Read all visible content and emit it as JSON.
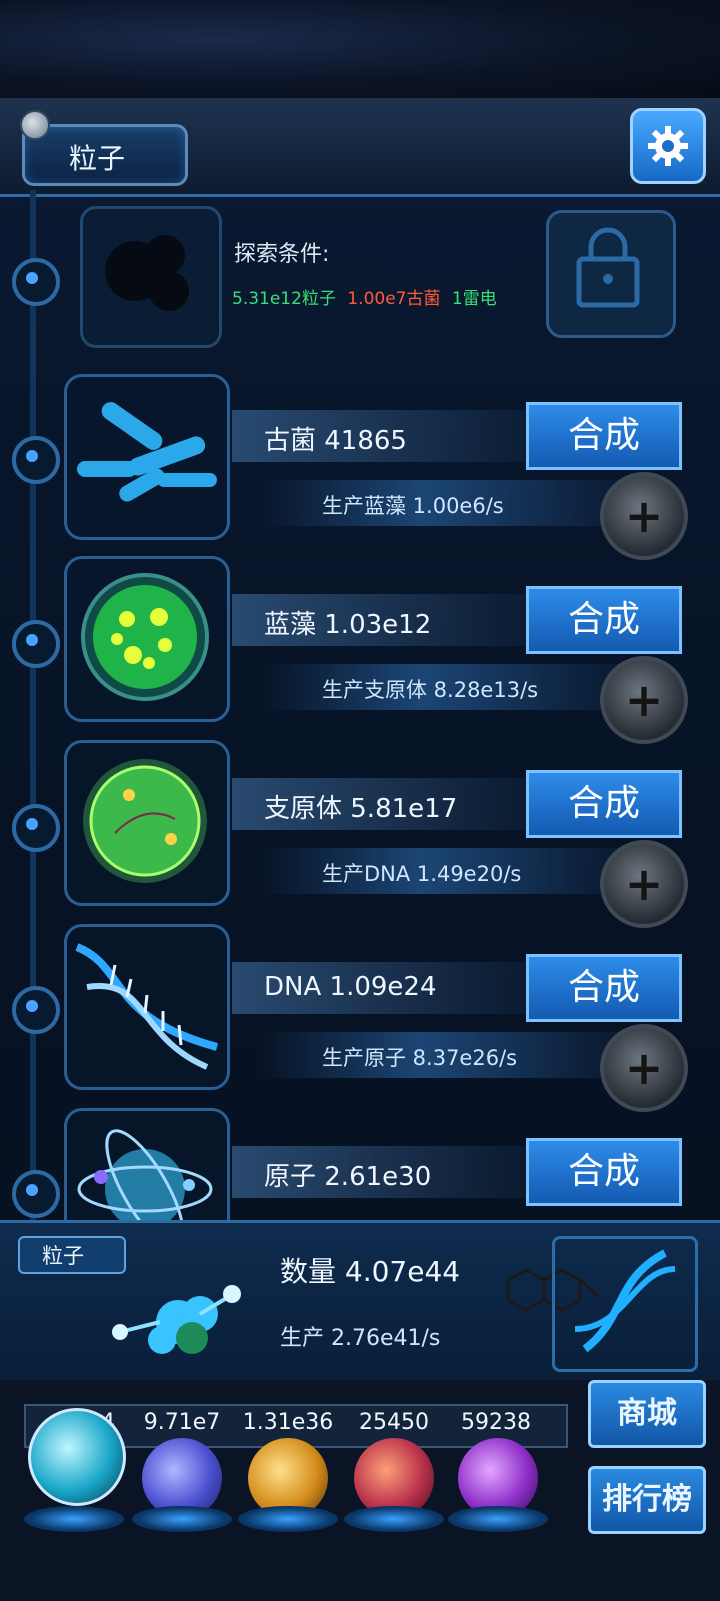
{
  "header": {
    "title": "粒子"
  },
  "explore": {
    "label": "探索条件:",
    "cond_particle": "5.31e12粒子",
    "cond_archaea": "1.00e7古菌",
    "cond_thunder": "1雷电"
  },
  "items": [
    {
      "name": "古菌 41865",
      "production": "生产蓝藻 1.00e6/s",
      "synth_label": "合成"
    },
    {
      "name": "蓝藻 1.03e12",
      "production": "生产支原体 8.28e13/s",
      "synth_label": "合成"
    },
    {
      "name": "支原体 5.81e17",
      "production": "生产DNA 1.49e20/s",
      "synth_label": "合成"
    },
    {
      "name": "DNA 1.09e24",
      "production": "生产原子 8.37e26/s",
      "synth_label": "合成"
    },
    {
      "name": "原子 2.61e30",
      "synth_label": "合成"
    }
  ],
  "summary": {
    "tab": "粒子",
    "quantity": "数量 4.07e44",
    "production": "生产 2.76e41/s"
  },
  "resources": [
    "4",
    "9.71e7",
    "1.31e36",
    "25450",
    "59238"
  ],
  "side_buttons": {
    "shop": "商城",
    "rank": "排行榜"
  },
  "colors": {
    "accent": "#2d8ce8",
    "condition_green": "#38e07a",
    "condition_red": "#ff5b3a"
  }
}
